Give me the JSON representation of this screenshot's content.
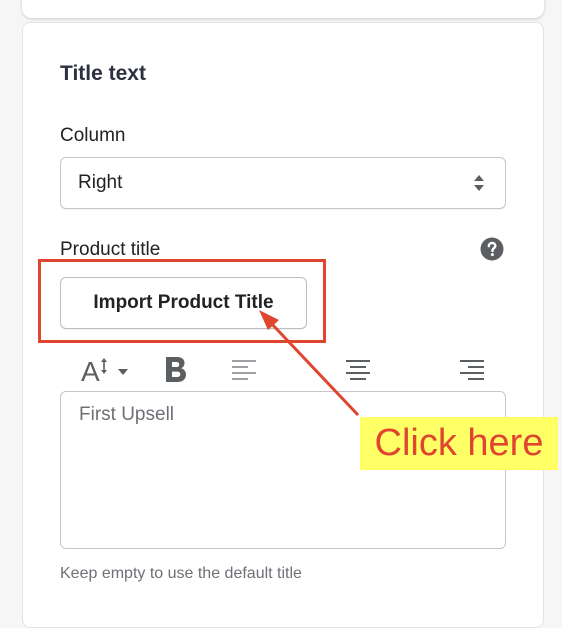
{
  "section": {
    "title": "Title text"
  },
  "column": {
    "label": "Column",
    "selected": "Right"
  },
  "product_title": {
    "label": "Product title",
    "import_button": "Import Product Title",
    "help_icon": "question-circle-icon"
  },
  "toolbar": {
    "icons": [
      "font-size-icon",
      "bold-icon",
      "align-left-icon",
      "align-center-icon",
      "align-right-icon"
    ]
  },
  "editor": {
    "value": "First Upsell",
    "hint": "Keep empty to use the default title"
  },
  "annotation": {
    "callout_text": "Click here",
    "color": "#e0452f",
    "callout_background": "#ffff66"
  }
}
